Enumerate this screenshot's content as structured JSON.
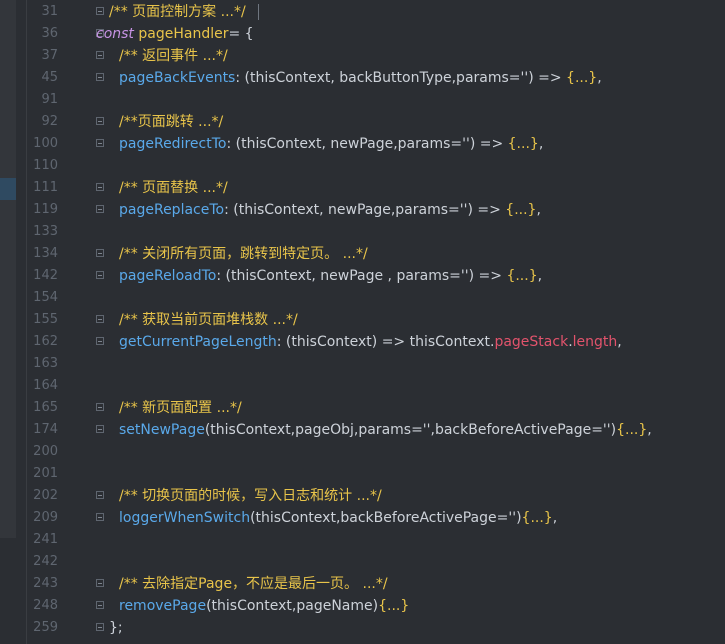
{
  "editor": {
    "lines": [
      {
        "num": "31",
        "parts": [
          [
            "/** 页面控制方案 ...*/",
            "cm"
          ]
        ]
      },
      {
        "num": "36",
        "parts": [
          [
            "const",
            "kw"
          ],
          [
            " ",
            "pl"
          ],
          [
            "pageHandler",
            "yl"
          ],
          [
            "= {",
            "pl"
          ]
        ]
      },
      {
        "num": "37",
        "parts": [
          [
            "/** 返回事件 ...*/",
            "cm"
          ]
        ]
      },
      {
        "num": "45",
        "parts": [
          [
            "pageBackEvents",
            "fn"
          ],
          [
            ": (thisContext, backButtonType,params='') => ",
            "pl"
          ],
          [
            "{...}",
            "yl"
          ],
          [
            ",",
            "pl"
          ]
        ]
      },
      {
        "num": "91",
        "parts": []
      },
      {
        "num": "92",
        "parts": [
          [
            "/**页面跳转 ...*/",
            "cm"
          ]
        ]
      },
      {
        "num": "100",
        "parts": [
          [
            "pageRedirectTo",
            "fn"
          ],
          [
            ": (thisContext, newPage,params='') => ",
            "pl"
          ],
          [
            "{...}",
            "yl"
          ],
          [
            ",",
            "pl"
          ]
        ]
      },
      {
        "num": "110",
        "parts": []
      },
      {
        "num": "111",
        "parts": [
          [
            "/** 页面替换 ...*/",
            "cm"
          ]
        ]
      },
      {
        "num": "119",
        "parts": [
          [
            "pageReplaceTo",
            "fn"
          ],
          [
            ": (thisContext, newPage,params='') => ",
            "pl"
          ],
          [
            "{...}",
            "yl"
          ],
          [
            ",",
            "pl"
          ]
        ]
      },
      {
        "num": "133",
        "parts": []
      },
      {
        "num": "134",
        "parts": [
          [
            "/** 关闭所有页面，跳转到特定页。 ...*/",
            "cm"
          ]
        ]
      },
      {
        "num": "142",
        "parts": [
          [
            "pageReloadTo",
            "fn"
          ],
          [
            ": (thisContext, newPage , params='') => ",
            "pl"
          ],
          [
            "{...}",
            "yl"
          ],
          [
            ",",
            "pl"
          ]
        ]
      },
      {
        "num": "154",
        "parts": []
      },
      {
        "num": "155",
        "parts": [
          [
            "/** 获取当前页面堆栈数 ...*/",
            "cm"
          ]
        ]
      },
      {
        "num": "162",
        "parts": [
          [
            "getCurrentPageLength",
            "fn"
          ],
          [
            ": (thisContext) => thisContext.",
            "pl"
          ],
          [
            "pageStack",
            "pr"
          ],
          [
            ".",
            "pl"
          ],
          [
            "length",
            "pr"
          ],
          [
            ",",
            "pl"
          ]
        ]
      },
      {
        "num": "163",
        "parts": []
      },
      {
        "num": "164",
        "parts": []
      },
      {
        "num": "165",
        "parts": [
          [
            "/** 新页面配置 ...*/",
            "cm"
          ]
        ]
      },
      {
        "num": "174",
        "parts": [
          [
            "setNewPage",
            "fn"
          ],
          [
            "(thisContext,pageObj,params='',backBeforeActivePage='')",
            "pl"
          ],
          [
            "{...}",
            "yl"
          ],
          [
            ",",
            "pl"
          ]
        ]
      },
      {
        "num": "200",
        "parts": []
      },
      {
        "num": "201",
        "parts": []
      },
      {
        "num": "202",
        "parts": [
          [
            "/** 切换页面的时候，写入日志和统计 ...*/",
            "cm"
          ]
        ]
      },
      {
        "num": "209",
        "parts": [
          [
            "loggerWhenSwitch",
            "fn"
          ],
          [
            "(thisContext,backBeforeActivePage='')",
            "pl"
          ],
          [
            "{...}",
            "yl"
          ],
          [
            ",",
            "pl"
          ]
        ]
      },
      {
        "num": "241",
        "parts": []
      },
      {
        "num": "242",
        "parts": []
      },
      {
        "num": "243",
        "parts": [
          [
            "/** 去除指定Page，不应是最后一页。 ...*/",
            "cm"
          ]
        ]
      },
      {
        "num": "248",
        "parts": [
          [
            "removePage",
            "fn"
          ],
          [
            "(thisContext,pageName)",
            "pl"
          ],
          [
            "{...}",
            "yl"
          ]
        ]
      },
      {
        "num": "259",
        "parts": [
          [
            "};",
            "pl"
          ]
        ]
      }
    ]
  },
  "colors": {
    "background": "#2b2e33",
    "comment": "#e8c44a",
    "keyword": "#c793e4",
    "function": "#5aa9ea",
    "plain": "#cdd2d9",
    "property": "#e2536c",
    "line_number": "#5f6670"
  }
}
